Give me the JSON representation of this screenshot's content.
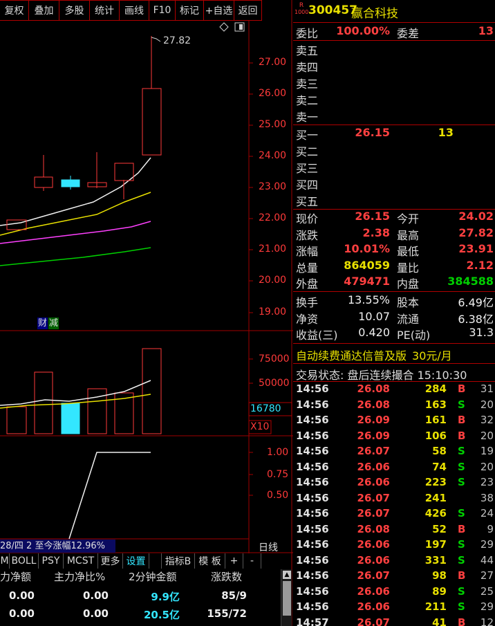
{
  "toolbar": [
    "复权",
    "叠加",
    "多股",
    "统计",
    "画线",
    "F10",
    "标记",
    "+自选",
    "返回"
  ],
  "kline": {
    "price_ticks": [
      "27.00",
      "26.00",
      "25.00",
      "24.00",
      "23.00",
      "22.00",
      "21.00",
      "20.00",
      "19.00"
    ],
    "high_label": "27.82",
    "badge_a": "财",
    "badge_b": "减"
  },
  "volume": {
    "ticks": [
      "75000",
      "50000"
    ],
    "current": "16780",
    "multiplier": "X10"
  },
  "indicator": {
    "ticks": [
      "1.00",
      "0.75",
      "0.50"
    ],
    "note": "28/四 2 至今涨幅12.96%",
    "period": "日线"
  },
  "tabs": [
    "M",
    "BOLL",
    "PSY",
    "MCST",
    "更多",
    "设置",
    "指标B",
    "模 板",
    "+",
    "-"
  ],
  "fund_flow": {
    "headers": [
      "力净额",
      "主力净比%",
      "2分钟金额",
      "涨跌数"
    ],
    "rows": [
      [
        "0.00",
        "0.00",
        "9.9亿",
        "85/9"
      ],
      [
        "0.00",
        "0.00",
        "20.5亿",
        "155/72"
      ]
    ]
  },
  "quote": {
    "code": "300457",
    "name": "赢合科技",
    "badge_top": "R",
    "badge_bottom": "1000",
    "ratio_label": "委比",
    "ratio_value": "100.00%",
    "diff_label": "委差",
    "diff_value": "13",
    "asks": [
      "卖五",
      "卖四",
      "卖三",
      "卖二",
      "卖一"
    ],
    "bids": [
      {
        "label": "买一",
        "price": "26.15",
        "vol": "13"
      },
      {
        "label": "买二",
        "price": "",
        "vol": ""
      },
      {
        "label": "买三",
        "price": "",
        "vol": ""
      },
      {
        "label": "买四",
        "price": "",
        "vol": ""
      },
      {
        "label": "买五",
        "price": "",
        "vol": ""
      }
    ],
    "stats": [
      {
        "l1": "现价",
        "v1": "26.15",
        "c1": "red",
        "l2": "今开",
        "v2": "24.02",
        "c2": "red"
      },
      {
        "l1": "涨跌",
        "v1": "2.38",
        "c1": "red",
        "l2": "最高",
        "v2": "27.82",
        "c2": "red"
      },
      {
        "l1": "涨幅",
        "v1": "10.01%",
        "c1": "red",
        "l2": "最低",
        "v2": "23.91",
        "c2": "red"
      },
      {
        "l1": "总量",
        "v1": "864059",
        "c1": "yellow",
        "l2": "量比",
        "v2": "2.12",
        "c2": "red"
      },
      {
        "l1": "外盘",
        "v1": "479471",
        "c1": "red",
        "l2": "内盘",
        "v2": "384588",
        "c2": "green"
      }
    ],
    "fundamentals": [
      {
        "l1": "换手",
        "v1": "13.55%",
        "l2": "股本",
        "v2": "6.49亿"
      },
      {
        "l1": "净资",
        "v1": "10.07",
        "l2": "流通",
        "v2": "6.38亿"
      },
      {
        "l1": "收益(三)",
        "v1": "0.420",
        "l2": "PE(动)",
        "v2": "31.3"
      }
    ],
    "promo": "自动续费通达信普及版",
    "promo_price": "30元/月",
    "status": "交易状态: 盘后连续撮合 15:10:30"
  },
  "ticks": [
    {
      "t": "14:56",
      "p": "26.08",
      "v": "284",
      "d": "B",
      "n": "31"
    },
    {
      "t": "14:56",
      "p": "26.08",
      "v": "163",
      "d": "S",
      "n": "20"
    },
    {
      "t": "14:56",
      "p": "26.09",
      "v": "161",
      "d": "B",
      "n": "32"
    },
    {
      "t": "14:56",
      "p": "26.09",
      "v": "106",
      "d": "B",
      "n": "20"
    },
    {
      "t": "14:56",
      "p": "26.07",
      "v": "58",
      "d": "S",
      "n": "19"
    },
    {
      "t": "14:56",
      "p": "26.06",
      "v": "74",
      "d": "S",
      "n": "20"
    },
    {
      "t": "14:56",
      "p": "26.06",
      "v": "223",
      "d": "S",
      "n": "23"
    },
    {
      "t": "14:56",
      "p": "26.07",
      "v": "241",
      "d": "",
      "n": "38"
    },
    {
      "t": "14:56",
      "p": "26.07",
      "v": "426",
      "d": "S",
      "n": "24"
    },
    {
      "t": "14:56",
      "p": "26.08",
      "v": "52",
      "d": "B",
      "n": "9"
    },
    {
      "t": "14:56",
      "p": "26.06",
      "v": "197",
      "d": "S",
      "n": "29"
    },
    {
      "t": "14:56",
      "p": "26.06",
      "v": "331",
      "d": "S",
      "n": "44"
    },
    {
      "t": "14:56",
      "p": "26.07",
      "v": "98",
      "d": "B",
      "n": "27"
    },
    {
      "t": "14:56",
      "p": "26.06",
      "v": "89",
      "d": "S",
      "n": "25"
    },
    {
      "t": "14:56",
      "p": "26.06",
      "v": "211",
      "d": "S",
      "n": "29"
    },
    {
      "t": "14:57",
      "p": "26.07",
      "v": "41",
      "d": "B",
      "n": "12"
    }
  ]
}
